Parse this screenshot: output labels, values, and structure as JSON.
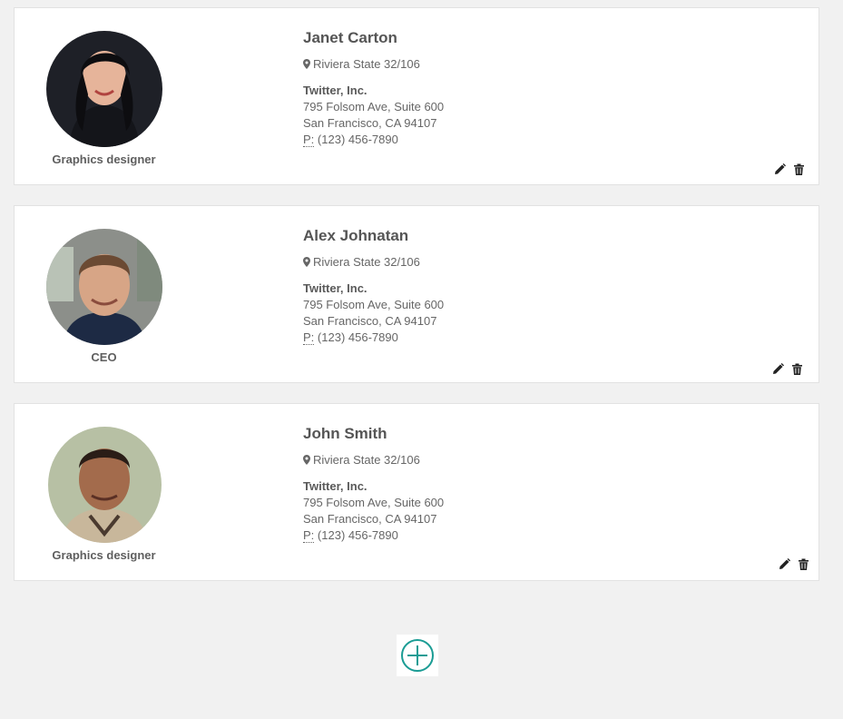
{
  "contacts": [
    {
      "name": "Janet Carton",
      "role": "Graphics designer",
      "address": "Riviera State 32/106",
      "company": "Twitter, Inc.",
      "street": "795 Folsom Ave, Suite 600",
      "city": "San Francisco, CA 94107",
      "phone_label": "P:",
      "phone": "(123) 456-7890"
    },
    {
      "name": "Alex Johnatan",
      "role": "CEO",
      "address": "Riviera State 32/106",
      "company": "Twitter, Inc.",
      "street": "795 Folsom Ave, Suite 600",
      "city": "San Francisco, CA 94107",
      "phone_label": "P:",
      "phone": "(123) 456-7890"
    },
    {
      "name": "John Smith",
      "role": "Graphics designer",
      "address": "Riviera State 32/106",
      "company": "Twitter, Inc.",
      "street": "795 Folsom Ave, Suite 600",
      "city": "San Francisco, CA 94107",
      "phone_label": "P:",
      "phone": "(123) 456-7890"
    }
  ],
  "icons": {
    "edit": "pencil-icon",
    "delete": "trash-icon",
    "location": "map-marker-icon",
    "add": "plus-circle-icon"
  },
  "colors": {
    "accent": "#1a9c94",
    "background": "#f1f1f1",
    "card": "#ffffff"
  }
}
